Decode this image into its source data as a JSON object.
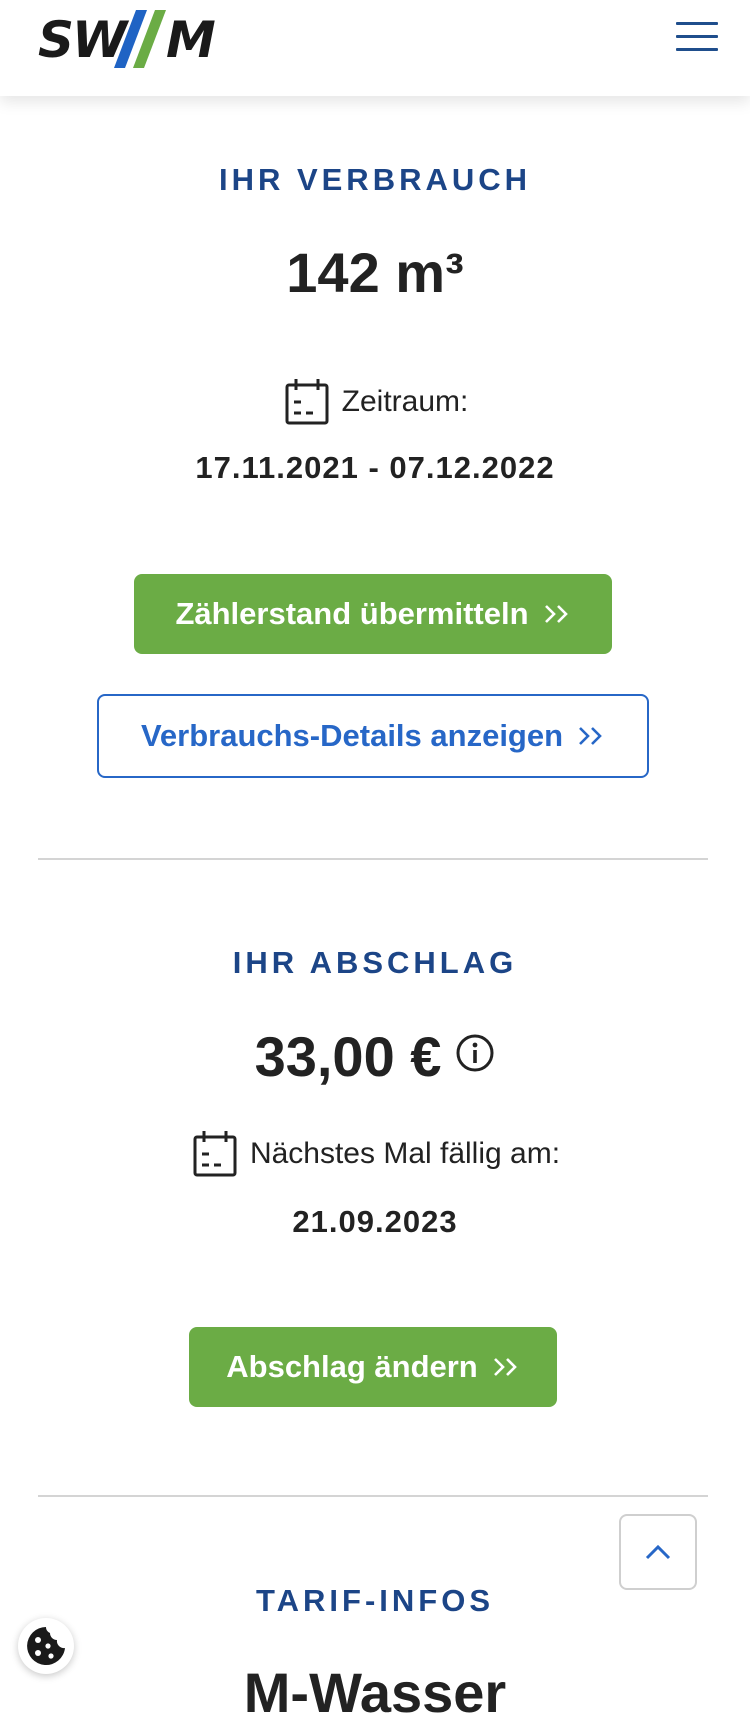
{
  "header": {
    "logo_left": "SW",
    "logo_right": "M",
    "logo_colors": [
      "#1f63c4",
      "#6bac45"
    ],
    "menu_icon": "hamburger-menu-icon"
  },
  "consumption": {
    "title": "IHR VERBRAUCH",
    "value": "142 m³",
    "period_label": "Zeitraum:",
    "period_value": "17.11.2021 - 07.12.2022",
    "submit_button": "Zählerstand übermitteln",
    "details_button": "Verbrauchs-Details anzeigen"
  },
  "installment": {
    "title": "IHR ABSCHLAG",
    "value": "33,00 €",
    "due_label": "Nächstes Mal fällig am:",
    "due_value": "21.09.2023",
    "change_button": "Abschlag ändern"
  },
  "tariff": {
    "title": "TARIF-INFOS",
    "name": "M-Wasser"
  },
  "colors": {
    "title_blue": "#1c4587",
    "link_blue": "#2767c7",
    "button_green": "#6bac45",
    "divider": "#d4d4d4"
  },
  "icons": {
    "calendar": "calendar-icon",
    "info": "info-icon",
    "chevron": "double-chevron-right-icon",
    "scroll_top": "chevron-up-icon",
    "cookie": "cookie-icon"
  }
}
